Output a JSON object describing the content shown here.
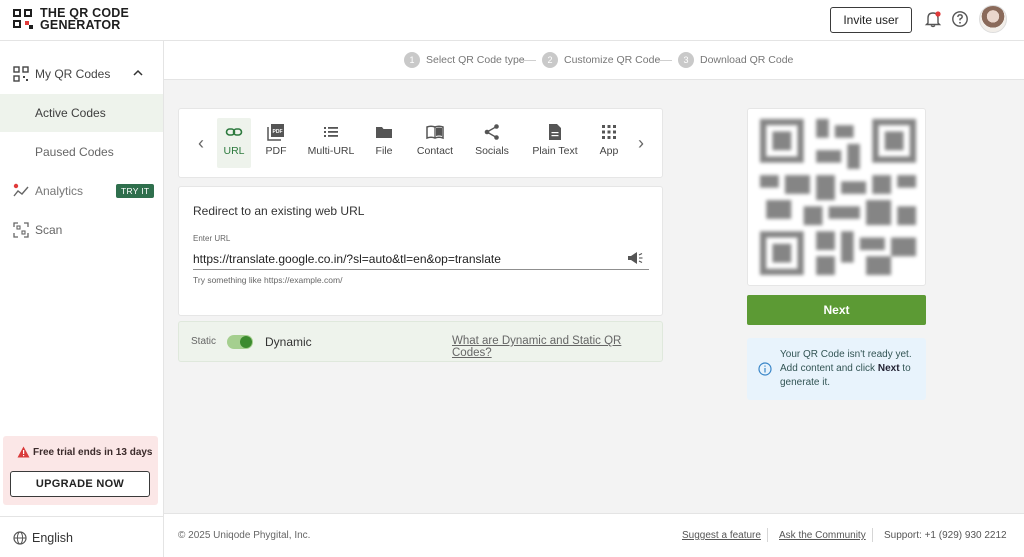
{
  "brand": {
    "logo_line1": "THE QR CODE",
    "logo_line2": "GENERATOR"
  },
  "header": {
    "invite_label": "Invite user",
    "icons": [
      "bell-icon",
      "help-icon"
    ],
    "accent": "#e03a3a"
  },
  "sidebar": {
    "items": [
      {
        "label": "My QR Codes",
        "icon": "qr-grid-icon"
      },
      {
        "label": "Active Codes"
      },
      {
        "label": "Paused Codes"
      },
      {
        "label": "Analytics",
        "icon": "analytics-icon",
        "badge": "TRY IT"
      },
      {
        "label": "Scan",
        "icon": "scan-icon"
      }
    ],
    "trial_text": "Free trial ends in 13 days",
    "upgrade_label": "UPGRADE NOW",
    "language": "English"
  },
  "stepper": {
    "steps": [
      {
        "num": "1",
        "label": "Select QR Code type"
      },
      {
        "num": "2",
        "label": "Customize QR Code"
      },
      {
        "num": "3",
        "label": "Download QR Code"
      }
    ]
  },
  "tabs": [
    {
      "label": "URL",
      "icon": "link-icon",
      "active": true
    },
    {
      "label": "PDF",
      "icon": "pdf-icon"
    },
    {
      "label": "Multi-URL",
      "icon": "list-icon"
    },
    {
      "label": "File",
      "icon": "folder-icon"
    },
    {
      "label": "Contact",
      "icon": "contact-book-icon"
    },
    {
      "label": "Socials",
      "icon": "share-icon"
    },
    {
      "label": "Plain Text",
      "icon": "document-icon"
    },
    {
      "label": "App",
      "icon": "app-grid-icon"
    }
  ],
  "form": {
    "title": "Redirect to an existing web URL",
    "field_label": "Enter URL",
    "url_value": "https://translate.google.co.in/?sl=auto&tl=en&op=translate",
    "hint": "Try something like https://example.com/"
  },
  "toggle": {
    "static_label": "Static",
    "dynamic_label": "Dynamic",
    "is_dynamic": true,
    "help_link": "What are Dynamic and Static QR Codes?"
  },
  "preview": {
    "next_label": "Next",
    "info_pre": "Your QR Code isn't ready yet. Add content and click ",
    "info_bold": "Next",
    "info_post": " to generate it."
  },
  "footer": {
    "copyright": "© 2025 Uniqode Phygital, Inc.",
    "links": [
      "Suggest a feature",
      "Ask the Community"
    ],
    "support": "Support:  +1 (929) 930 2212"
  },
  "colors": {
    "primary_green": "#5c9a34",
    "active_bg": "#eef3ec",
    "badge_green": "#2f6f4d",
    "trial_bg": "#fbe7e7",
    "info_bg": "#e8f3fc"
  }
}
